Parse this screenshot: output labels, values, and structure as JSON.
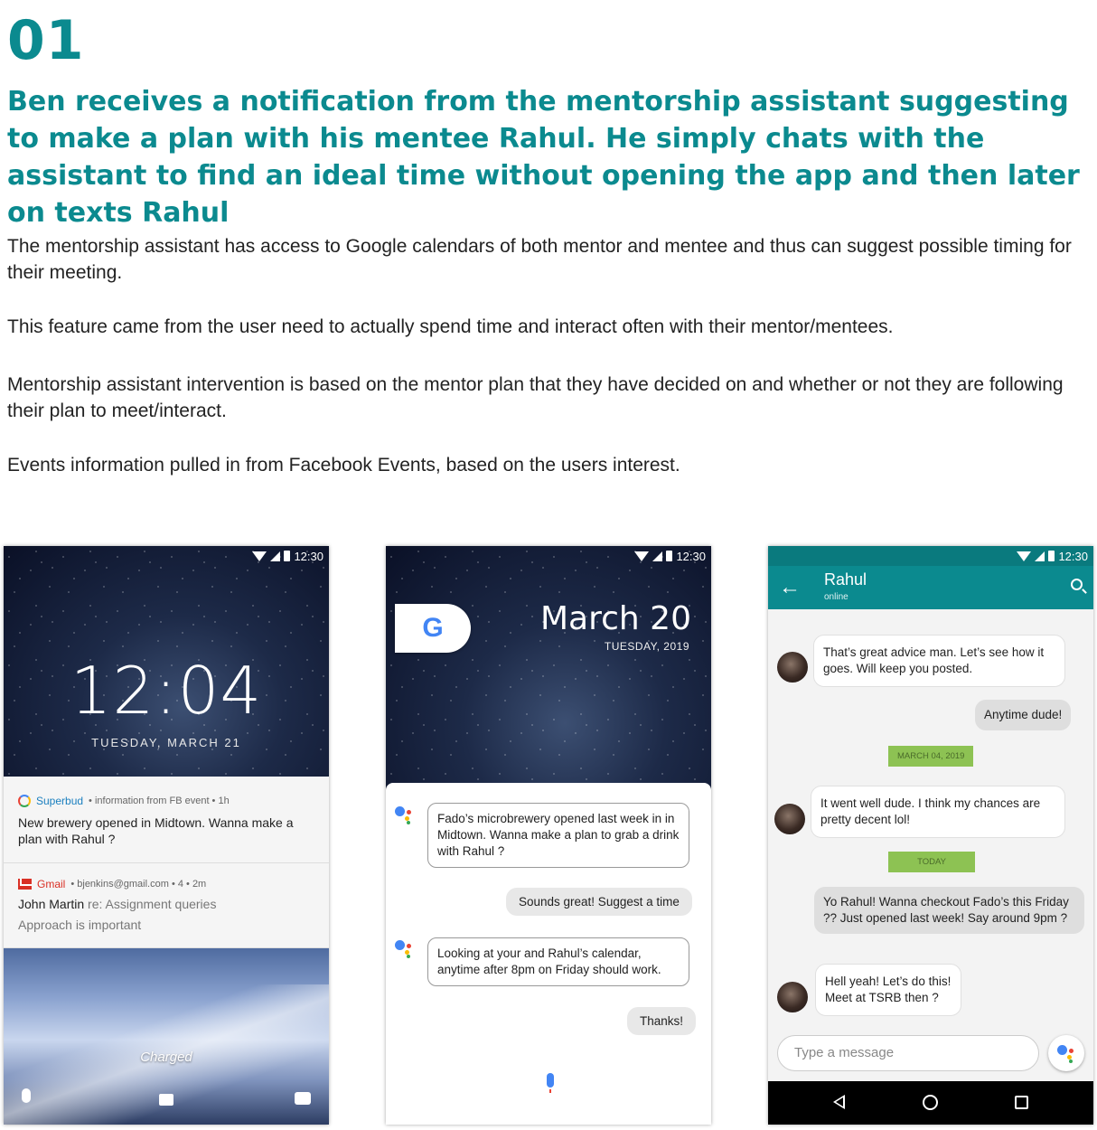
{
  "step_number": "01",
  "headline": "Ben receives a notification from the mentorship assistant suggesting to make a plan with his mentee Rahul. He simply chats with the assistant to find an ideal time without opening the app and then later on texts Rahul",
  "paragraphs": [
    "The mentorship assistant has access to Google calendars of both mentor and mentee and thus can suggest possible timing for their meeting.",
    "This feature came from the user need to actually spend time and interact often with their mentor/mentees.",
    "Mentorship assistant intervention is based on the mentor plan that they have decided on and whether or not they are following their plan to meet/interact.",
    "Events information pulled in from Facebook Events, based on the users interest."
  ],
  "status_time": "12:30",
  "phone1": {
    "clock": "12:04",
    "date": "TUESDAY, MARCH 21",
    "notifications": [
      {
        "app": "Superbud",
        "meta": "• information from FB event  • 1h",
        "body": "New brewery opened in Midtown. Wanna make a plan with Rahul ?"
      },
      {
        "app": "Gmail",
        "meta": "• bjenkins@gmail.com • 4 •  2m",
        "sender": "John Martin",
        "subject": "re: Assignment queries",
        "preview": "Approach is important"
      }
    ],
    "charged_label": "Charged"
  },
  "phone2": {
    "google_logo": "G",
    "date": "March 20",
    "sub_date": "TUESDAY, 2019",
    "messages": [
      "Fado’s microbrewery opened last week in in Midtown. Wanna make a plan to grab a drink with Rahul ?",
      "Sounds great! Suggest a time",
      "Looking at your and Rahul’s calendar, anytime after 8pm on Friday should work.",
      "Thanks!"
    ]
  },
  "phone3": {
    "contact": "Rahul",
    "contact_status": "online",
    "messages": {
      "in1": "That’s great advice man. Let’s see how it goes. Will keep you posted.",
      "out1": "Anytime dude!",
      "chip1": "MARCH 04, 2019",
      "in2": "It went well dude. I think my chances are pretty decent lol!",
      "chip2": "TODAY",
      "out2": "Yo Rahul! Wanna checkout Fado’s this Friday ?? Just opened last week! Say around 9pm ?",
      "in3": "Hell yeah! Let’s do this! Meet at TSRB then ?"
    },
    "input_placeholder": "Type a message"
  },
  "icons": {
    "wifi": "wifi-icon",
    "signal": "signal-icon",
    "battery": "battery-icon",
    "mic": "mic-icon",
    "lock": "lock-icon",
    "camera": "camera-icon",
    "back": "back-arrow-icon",
    "search": "search-icon",
    "assistant": "google-assistant-icon"
  },
  "colors": {
    "accent": "#0b8a8f",
    "date_chip": "#8dc253"
  }
}
